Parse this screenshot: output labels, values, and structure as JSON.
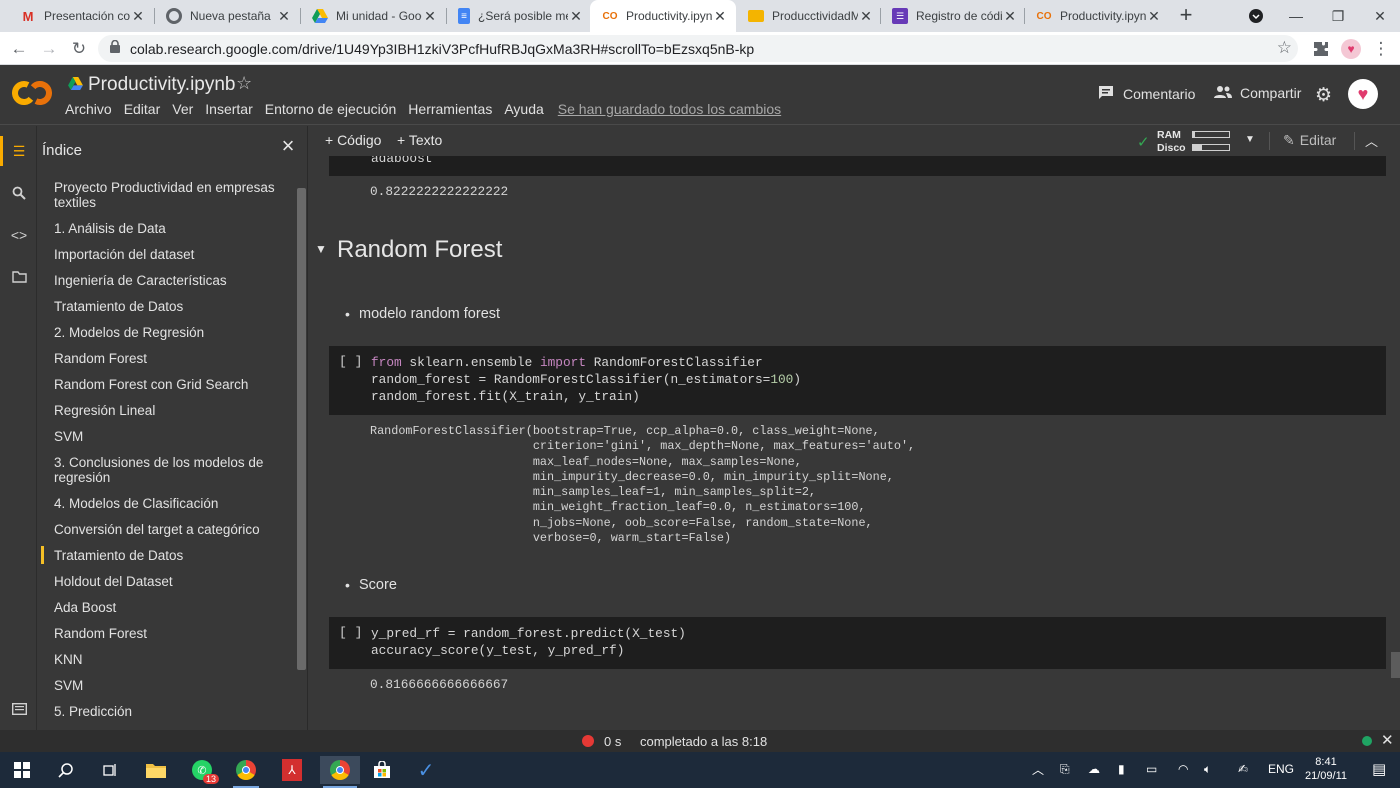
{
  "browser": {
    "tabs": [
      {
        "title": "Presentación com",
        "favicon": "gmail-icon",
        "color": "#d93025"
      },
      {
        "title": "Nueva pestaña",
        "favicon": "chrome-icon",
        "color": "#5f6368"
      },
      {
        "title": "Mi unidad - Goog",
        "favicon": "drive-icon",
        "color": "#0f9d58"
      },
      {
        "title": "¿Será posible mej",
        "favicon": "docs-icon",
        "color": "#4285f4"
      },
      {
        "title": "Productivity.ipynb",
        "favicon": "colab-icon",
        "color": "#e8710a",
        "active": true
      },
      {
        "title": "ProducctividadMl",
        "favicon": "slides-icon",
        "color": "#f4b400"
      },
      {
        "title": "Registro de códig",
        "favicon": "forms-icon",
        "color": "#673ab7"
      },
      {
        "title": "Productivity.ipynb",
        "favicon": "colab-icon",
        "color": "#e8710a"
      }
    ],
    "new_tab": "+",
    "url": "colab.research.google.com/drive/1U49Yp3IBH1zkiV3PcfHufRBJqGxMa3RH#scrollTo=bEzsxq5nB-kp"
  },
  "colab": {
    "logo_text": "CO",
    "notebook_title": "Productivity.ipynb",
    "menus": [
      "Archivo",
      "Editar",
      "Ver",
      "Insertar",
      "Entorno de ejecución",
      "Herramientas",
      "Ayuda"
    ],
    "saved_status": "Se han guardado todos los cambios",
    "comment_label": "Comentario",
    "share_label": "Compartir"
  },
  "sidebar": {
    "title": "Índice",
    "items": [
      {
        "label": "Proyecto Productividad en empresas textiles"
      },
      {
        "label": "1. Análisis de Data"
      },
      {
        "label": "Importación del dataset"
      },
      {
        "label": "Ingeniería de Características"
      },
      {
        "label": "Tratamiento de Datos"
      },
      {
        "label": "2. Modelos de Regresión"
      },
      {
        "label": "Random Forest"
      },
      {
        "label": "Random Forest con Grid Search"
      },
      {
        "label": "Regresión Lineal"
      },
      {
        "label": "SVM"
      },
      {
        "label": "3. Conclusiones de los modelos de regresión"
      },
      {
        "label": "4. Modelos de Clasificación"
      },
      {
        "label": "Conversión del target a categórico"
      },
      {
        "label": "Tratamiento de Datos",
        "active": true
      },
      {
        "label": "Holdout del Dataset"
      },
      {
        "label": "Ada Boost"
      },
      {
        "label": "Random Forest"
      },
      {
        "label": "KNN"
      },
      {
        "label": "SVM"
      },
      {
        "label": "5. Predicción"
      }
    ]
  },
  "notebook_toolbar": {
    "add_code": "+ Código",
    "add_text": "+ Texto",
    "ram_label": "RAM",
    "disk_label": "Disco",
    "ram_fraction": 0.05,
    "disk_fraction": 0.25,
    "edit_label": "Editar"
  },
  "cells": {
    "prev_tail_code": "adaboost",
    "prev_output": "0.8222222222222222",
    "heading": "Random Forest",
    "bullet1": "modelo random forest",
    "cell1_run": "[ ]",
    "cell1": {
      "l1_kw1": "from",
      "l1_mod": " sklearn.ensemble ",
      "l1_kw2": "import",
      "l1_name": " RandomForestClassifier",
      "l2_pre": "random_forest = RandomForestClassifier(n_estimators=",
      "l2_num": "100",
      "l2_post": ")",
      "l3": "random_forest.fit(X_train, y_train)"
    },
    "cell1_output": [
      "RandomForestClassifier(bootstrap=True, ccp_alpha=0.0, class_weight=None,",
      "                       criterion='gini', max_depth=None, max_features='auto',",
      "                       max_leaf_nodes=None, max_samples=None,",
      "                       min_impurity_decrease=0.0, min_impurity_split=None,",
      "                       min_samples_leaf=1, min_samples_split=2,",
      "                       min_weight_fraction_leaf=0.0, n_estimators=100,",
      "                       n_jobs=None, oob_score=False, random_state=None,",
      "                       verbose=0, warm_start=False)"
    ],
    "bullet2": "Score",
    "cell2_run": "[ ]",
    "cell2_lines": [
      "y_pred_rf = random_forest.predict(X_test)",
      "accuracy_score(y_test, y_pred_rf)"
    ],
    "cell2_output": "0.8166666666666667"
  },
  "statusbar": {
    "time": "0 s",
    "message": "completado a las 8:18"
  },
  "taskbar": {
    "whatsapp_badge": "13",
    "lang": "ENG",
    "time": "8:41",
    "date": "21/09/11"
  }
}
